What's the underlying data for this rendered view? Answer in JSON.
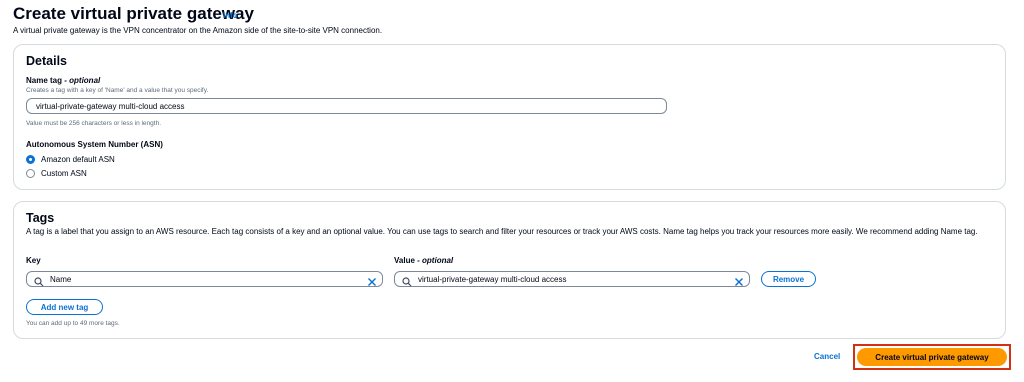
{
  "header": {
    "title": "Create virtual private gateway",
    "info_label": "Info",
    "description": "A virtual private gateway is the VPN concentrator on the Amazon side of the site-to-site VPN connection."
  },
  "details": {
    "heading": "Details",
    "name_tag": {
      "label": "Name tag",
      "optional": "- optional",
      "hint": "Creates a tag with a key of 'Name' and a value that you specify.",
      "value": "virtual-private-gateway multi-cloud access",
      "constraint": "Value must be 256 characters or less in length."
    },
    "asn": {
      "label": "Autonomous System Number (ASN)",
      "options": [
        {
          "label": "Amazon default ASN",
          "selected": true
        },
        {
          "label": "Custom ASN",
          "selected": false
        }
      ]
    }
  },
  "tags": {
    "heading": "Tags",
    "description": "A tag is a label that you assign to an AWS resource. Each tag consists of a key and an optional value. You can use tags to search and filter your resources or track your AWS costs. Name tag helps you track your resources more easily. We recommend adding Name tag.",
    "key_label": "Key",
    "value_label": "Value",
    "value_optional": "- optional",
    "rows": [
      {
        "key": "Name",
        "value": "virtual-private-gateway multi-cloud access"
      }
    ],
    "remove_label": "Remove",
    "add_label": "Add new tag",
    "limit_hint": "You can add up to 49 more tags."
  },
  "footer": {
    "cancel_label": "Cancel",
    "create_label": "Create virtual private gateway"
  },
  "colors": {
    "link": "#0972d3",
    "primary": "#ff9900",
    "highlight": "#d13212"
  }
}
